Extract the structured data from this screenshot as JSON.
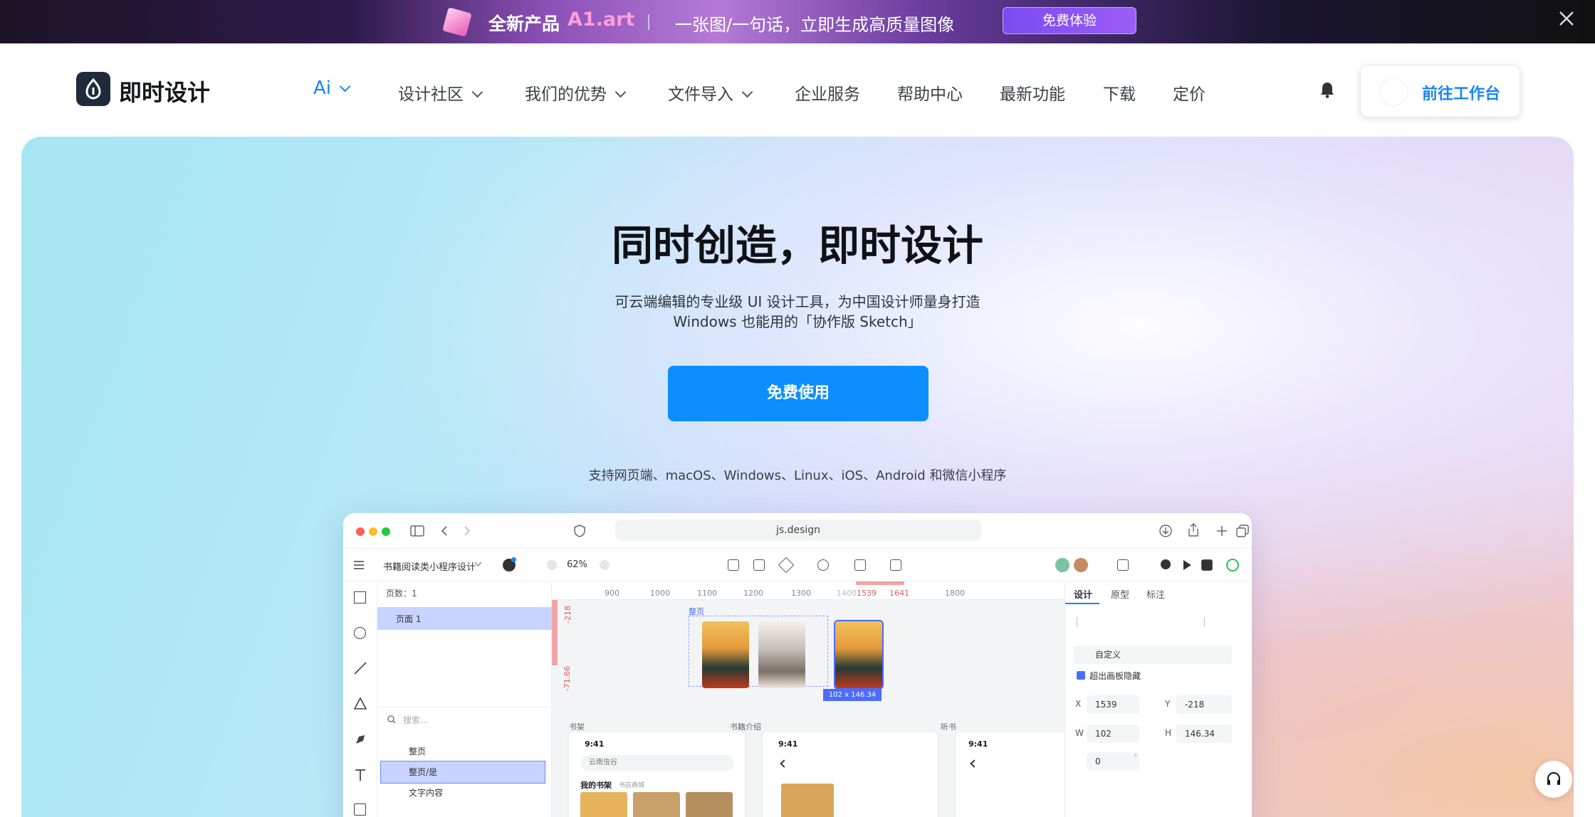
{
  "promo": {
    "label_new": "全新产品",
    "brand": "A1.art",
    "tagline": "一张图/一句话，立即生成高质量图像",
    "cta": "免费体验"
  },
  "nav": {
    "logo_text": "即时设计",
    "items": [
      "Ai",
      "设计社区",
      "我们的优势",
      "文件导入",
      "企业服务",
      "帮助中心",
      "最新功能",
      "下载",
      "定价"
    ],
    "workspace_button": "前往工作台"
  },
  "hero": {
    "title": "同时创造，即时设计",
    "subtitle_line1": "可云端编辑的专业级 UI 设计工具，为中国设计师量身打造",
    "subtitle_line2": "Windows 也能用的「协作版 Sketch」",
    "cta": "免费使用",
    "platforms": "支持网页端、macOS、Windows、Linux、iOS、Android 和微信小程序"
  },
  "mockup": {
    "url": "js.design",
    "file_name": "书籍阅读类小程序设计",
    "zoom": "62%",
    "pages_label": "页数：1",
    "page_item": "页面 1",
    "search_placeholder": "搜索...",
    "layers": [
      "整页",
      "整页/是",
      "文字内容"
    ],
    "ruler_ticks": [
      "900",
      "1000",
      "1100",
      "1200",
      "1300",
      "1400",
      "1539",
      "1641",
      "1800"
    ],
    "ruler_v": [
      "-218",
      "-71.66"
    ],
    "frame_label": "整页",
    "selection_size": "102 x 146.34",
    "section_labels": [
      "书架",
      "书籍介绍",
      "听书"
    ],
    "phone_time": "9:41",
    "search_box": "云南虫谷",
    "shelf_tabs": [
      "我的书架",
      "书店商城"
    ],
    "right_tabs": [
      "设计",
      "原型",
      "标注"
    ],
    "frame_preset": "自定义",
    "clip_label": "超出画板隐藏",
    "fields": {
      "x": "1539",
      "y": "-218",
      "w": "102",
      "h": "146.34",
      "rotation": "0"
    },
    "field_labels": {
      "x": "X",
      "y": "Y",
      "w": "W",
      "h": "H"
    },
    "rotation_unit": "°"
  }
}
